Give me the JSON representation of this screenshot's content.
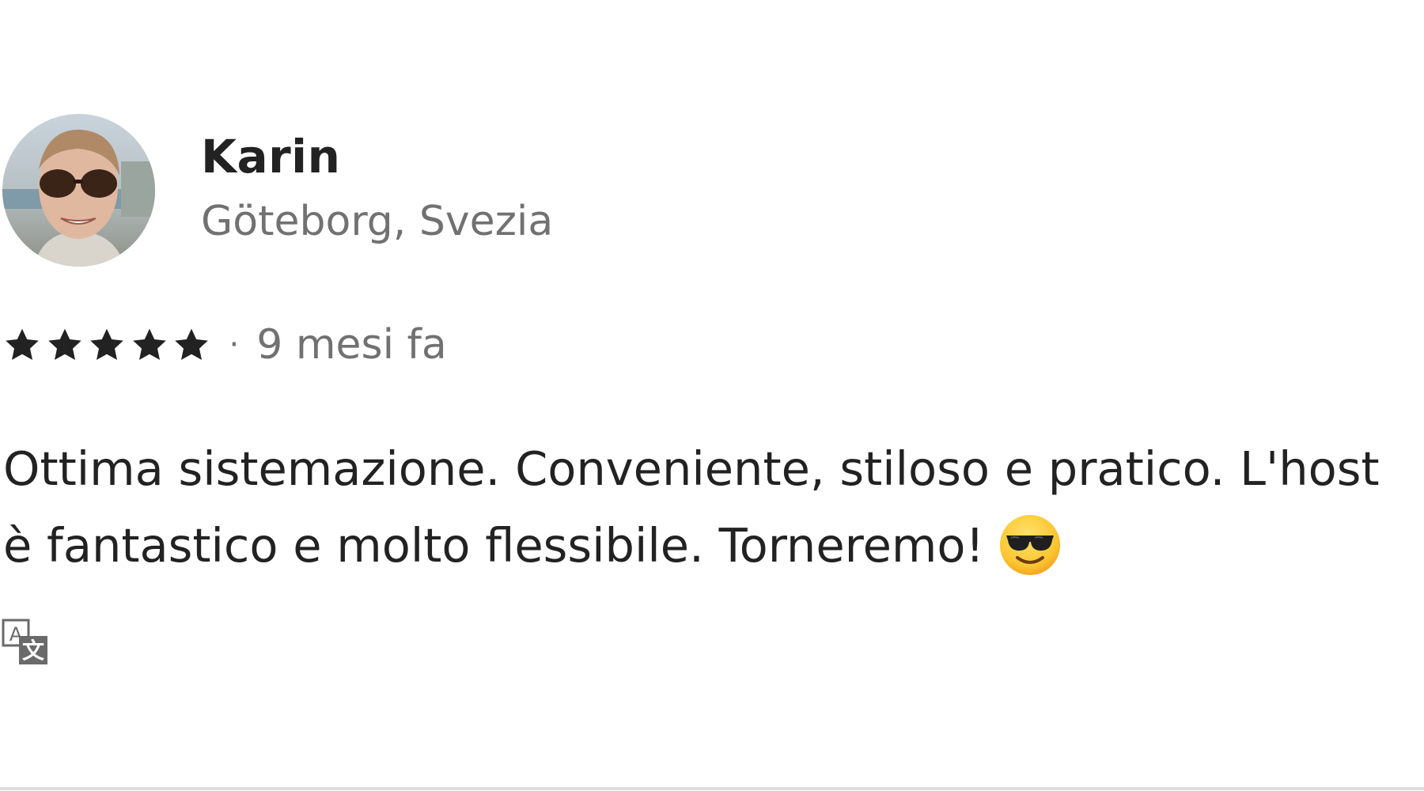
{
  "review": {
    "reviewer_name": "Karin",
    "reviewer_location": "Göteborg, Svezia",
    "rating": 5,
    "rating_max": 5,
    "separator": "·",
    "time_ago": "9 mesi fa",
    "text_line_1": "Ottima sistemazione. Conveniente, stiloso e pratico. L'host",
    "text_line_2": "è fantastico e molto flessibile. Torneremo!",
    "emoji": "smiling-face-with-sunglasses-icon",
    "translate_icon": "translate-icon"
  },
  "colors": {
    "primary_text": "#222222",
    "secondary_text": "#717171",
    "star": "#222222",
    "divider": "#dddddd"
  }
}
